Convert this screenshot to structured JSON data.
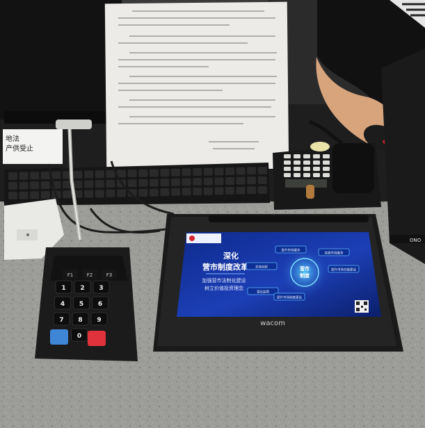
{
  "notice": {
    "footer_org": "",
    "footer_date": ""
  },
  "tablet": {
    "brand": "wacom",
    "screen": {
      "logo_text": "",
      "headline_1": "深化",
      "headline_2": "营市制度改革",
      "sub_1": "加强营市法制化建设",
      "sub_2": "树立价值投资理念",
      "center_label_1": "营市",
      "center_label_2": "制度",
      "nodes": [
        "提升市场服务",
        "完善市场服务",
        "支持创新",
        "提升市场功能建设",
        "强化监管",
        "提升市场制度建设"
      ]
    }
  },
  "keypad": {
    "fn_keys": [
      "F1",
      "F2",
      "F3"
    ],
    "digit_keys": [
      "1",
      "2",
      "3",
      "4",
      "5",
      "6",
      "7",
      "8",
      "9",
      "0"
    ],
    "colors": {
      "cancel": "#3f86d6",
      "enter": "#e0323c"
    }
  },
  "left_card": {
    "line_1": "地法",
    "line_2": "产供受止"
  },
  "phone_brand": "",
  "monitor_brand": "ONO"
}
